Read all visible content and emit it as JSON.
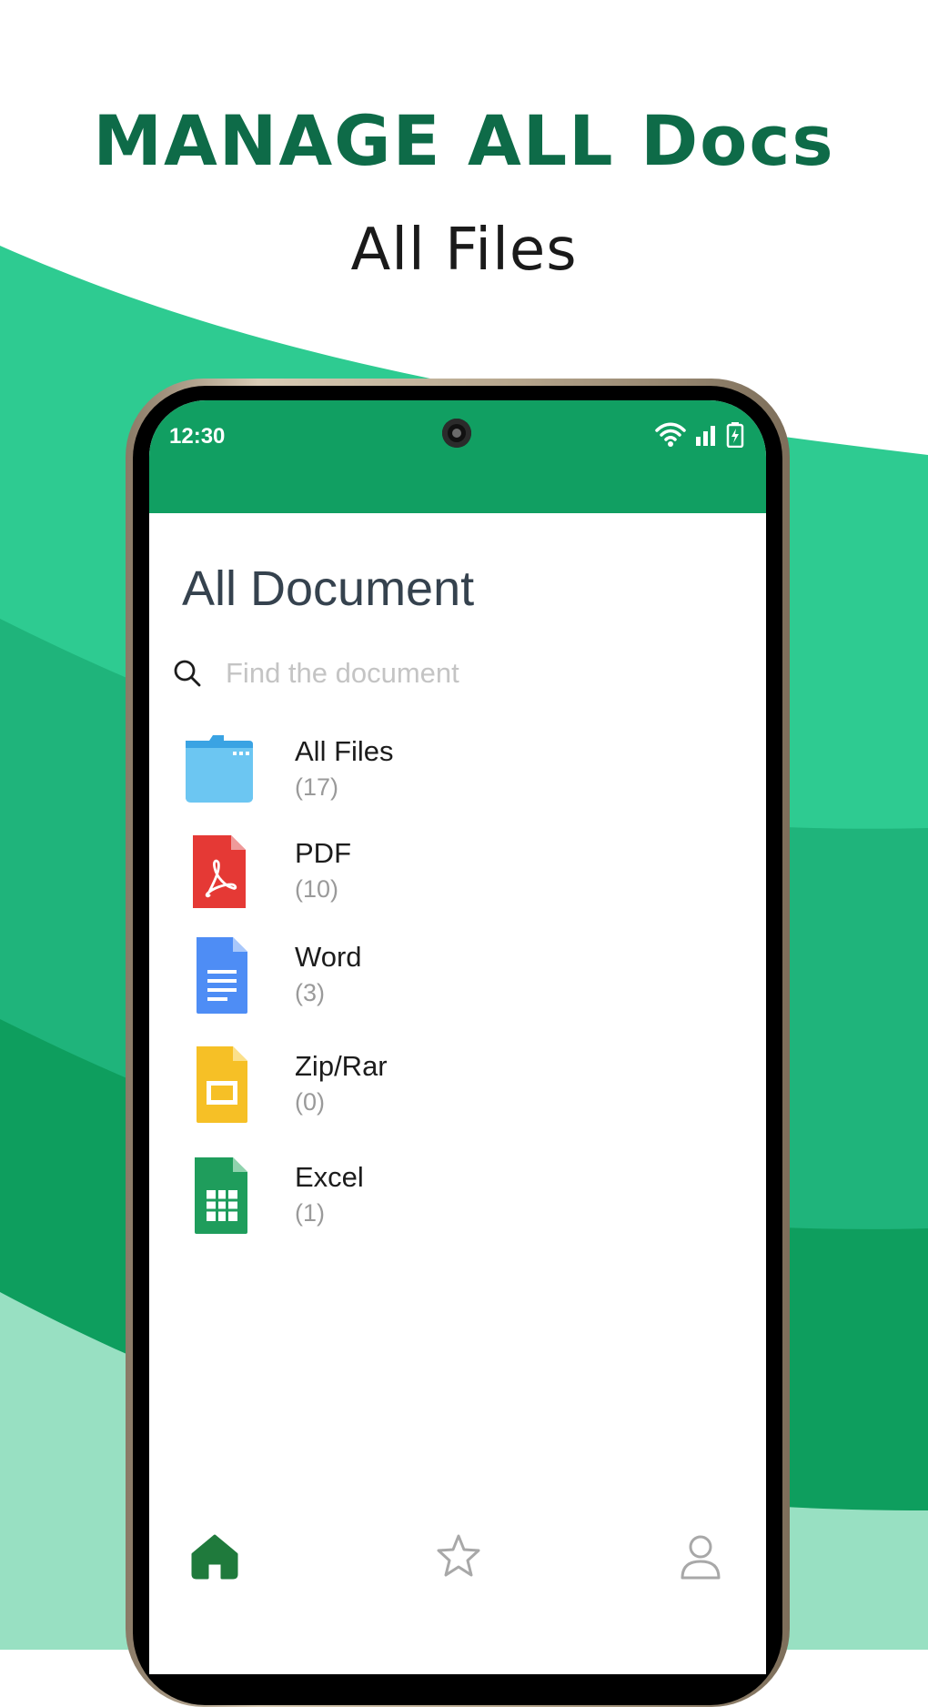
{
  "promo": {
    "headline": "MANAGE ALL Docs",
    "subheadline": "All Files"
  },
  "colors": {
    "brand_dark_green": "#0e6b48",
    "status_bar_green": "#119f62",
    "wave_light": "#2ecb91",
    "wave_mid": "#1fb47b",
    "wave_dark": "#0e9e5e",
    "wave_pale": "#98e0c2"
  },
  "status_bar": {
    "time": "12:30",
    "icons": [
      "wifi-icon",
      "signal-icon",
      "battery-charging-icon"
    ]
  },
  "screen": {
    "title": "All Document",
    "search": {
      "placeholder": "Find the document",
      "value": ""
    },
    "documents": [
      {
        "label": "All Files",
        "count": "(17)",
        "icon": "folder-icon"
      },
      {
        "label": "PDF",
        "count": "(10)",
        "icon": "pdf-file-icon"
      },
      {
        "label": "Word",
        "count": "(3)",
        "icon": "word-file-icon"
      },
      {
        "label": "Zip/Rar",
        "count": "(0)",
        "icon": "slides-file-icon"
      },
      {
        "label": "Excel",
        "count": "(1)",
        "icon": "excel-file-icon"
      }
    ],
    "bottom_nav": [
      {
        "name": "home",
        "icon": "home-icon",
        "active": true
      },
      {
        "name": "favorites",
        "icon": "star-icon",
        "active": false
      },
      {
        "name": "profile",
        "icon": "user-icon",
        "active": false
      }
    ]
  }
}
